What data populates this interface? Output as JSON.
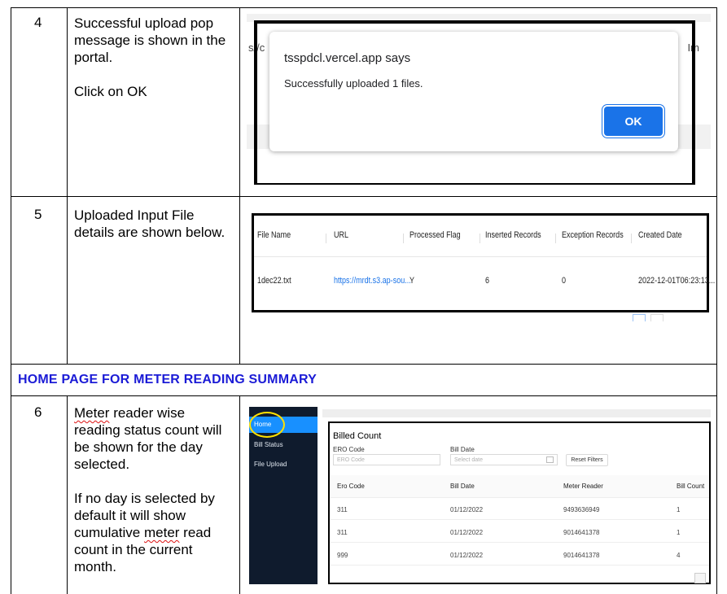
{
  "rows": [
    {
      "number": "4",
      "desc_paragraphs": [
        "Successful upload pop message is shown in the portal.",
        "Click on OK"
      ]
    },
    {
      "number": "5",
      "desc_paragraphs": [
        "Uploaded Input File details are shown below."
      ]
    },
    {
      "number": "6",
      "desc_line1_word": "Meter",
      "desc_line1_rest": " reader wise reading status count will be shown for the day selected.",
      "desc_p2_before": "If no day is selected by default it will show cumulative ",
      "desc_p2_word": "meter",
      "desc_p2_after": " read count in the current month."
    }
  ],
  "section_heading": "HOME PAGE FOR METER READING SUMMARY",
  "screenshot4": {
    "url_fragment": "s//c",
    "right_fragment": "Im",
    "dialog_title": "tsspdcl.vercel.app says",
    "dialog_message": "Successfully uploaded 1 files.",
    "ok_label": "OK",
    "ok_color": "#1a73e8"
  },
  "screenshot5": {
    "columns": [
      "File Name",
      "URL",
      "Processed Flag",
      "Inserted Records",
      "Exception Records",
      "Created Date"
    ],
    "row": [
      "1dec22.txt",
      "https://mrdt.s3.ap-sou...",
      "Y",
      "6",
      "0",
      "2022-12-01T06:23:13..."
    ]
  },
  "screenshot6": {
    "nav": [
      "Home",
      "Bill Status",
      "File Upload"
    ],
    "panel_title": "Billed Count",
    "ero_label": "ERO Code",
    "ero_placeholder": "ERO Code",
    "date_label": "Bill Date",
    "date_placeholder": "Select date",
    "reset_label": "Reset Filters",
    "columns": [
      "Ero Code",
      "Bill Date",
      "Meter Reader",
      "Bill Count"
    ],
    "rows": [
      [
        "311",
        "01/12/2022",
        "9493636949",
        "1"
      ],
      [
        "311",
        "01/12/2022",
        "9014641378",
        "1"
      ],
      [
        "999",
        "01/12/2022",
        "9014641378",
        "4"
      ]
    ],
    "sidebar_color": "#0f1b2d",
    "active_color": "#1890ff"
  }
}
